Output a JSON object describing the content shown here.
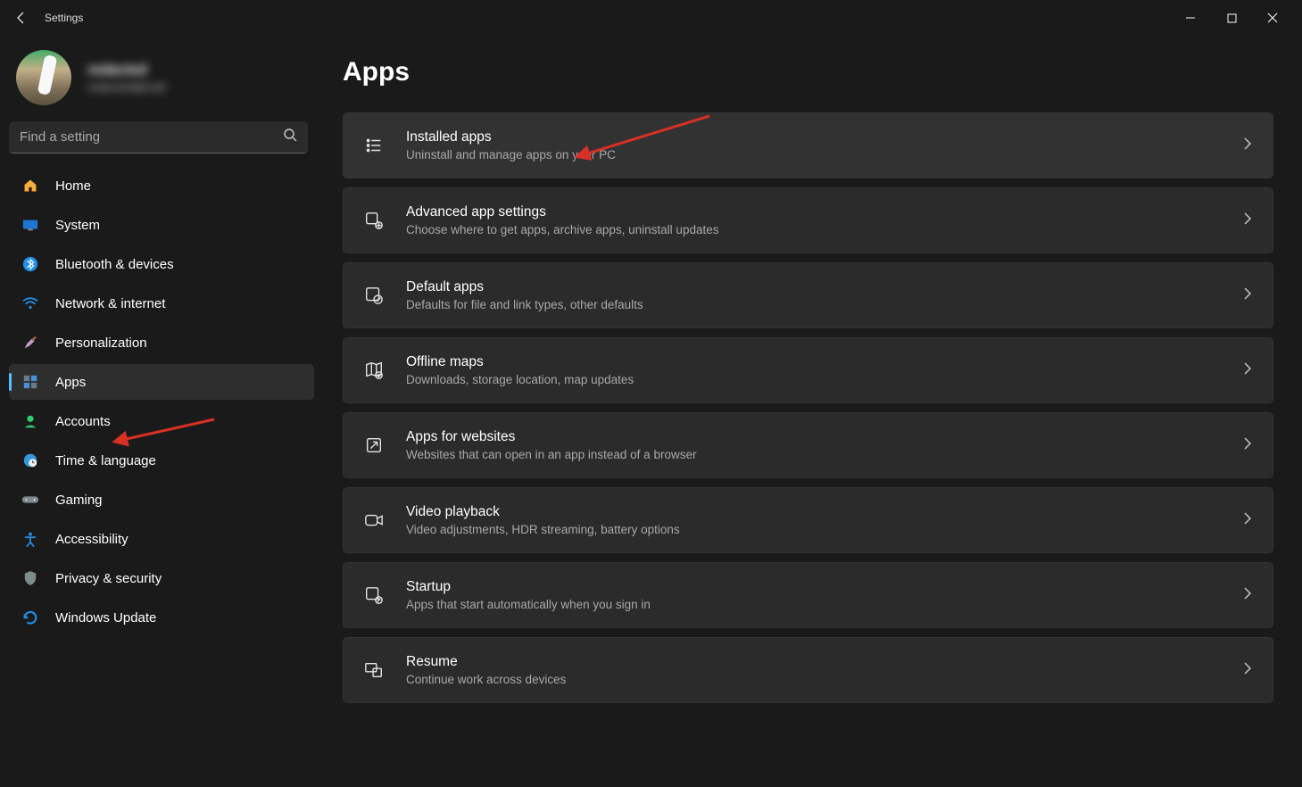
{
  "app": {
    "title": "Settings"
  },
  "user": {
    "name": "redacted",
    "email": "redacted@mail"
  },
  "search": {
    "placeholder": "Find a setting"
  },
  "sidebar": {
    "items": [
      {
        "label": "Home"
      },
      {
        "label": "System"
      },
      {
        "label": "Bluetooth & devices"
      },
      {
        "label": "Network & internet"
      },
      {
        "label": "Personalization"
      },
      {
        "label": "Apps"
      },
      {
        "label": "Accounts"
      },
      {
        "label": "Time & language"
      },
      {
        "label": "Gaming"
      },
      {
        "label": "Accessibility"
      },
      {
        "label": "Privacy & security"
      },
      {
        "label": "Windows Update"
      }
    ],
    "active_index": 5
  },
  "page": {
    "title": "Apps"
  },
  "cards": [
    {
      "title": "Installed apps",
      "desc": "Uninstall and manage apps on your PC",
      "highlight": true
    },
    {
      "title": "Advanced app settings",
      "desc": "Choose where to get apps, archive apps, uninstall updates"
    },
    {
      "title": "Default apps",
      "desc": "Defaults for file and link types, other defaults"
    },
    {
      "title": "Offline maps",
      "desc": "Downloads, storage location, map updates"
    },
    {
      "title": "Apps for websites",
      "desc": "Websites that can open in an app instead of a browser"
    },
    {
      "title": "Video playback",
      "desc": "Video adjustments, HDR streaming, battery options"
    },
    {
      "title": "Startup",
      "desc": "Apps that start automatically when you sign in"
    },
    {
      "title": "Resume",
      "desc": "Continue work across devices"
    }
  ]
}
